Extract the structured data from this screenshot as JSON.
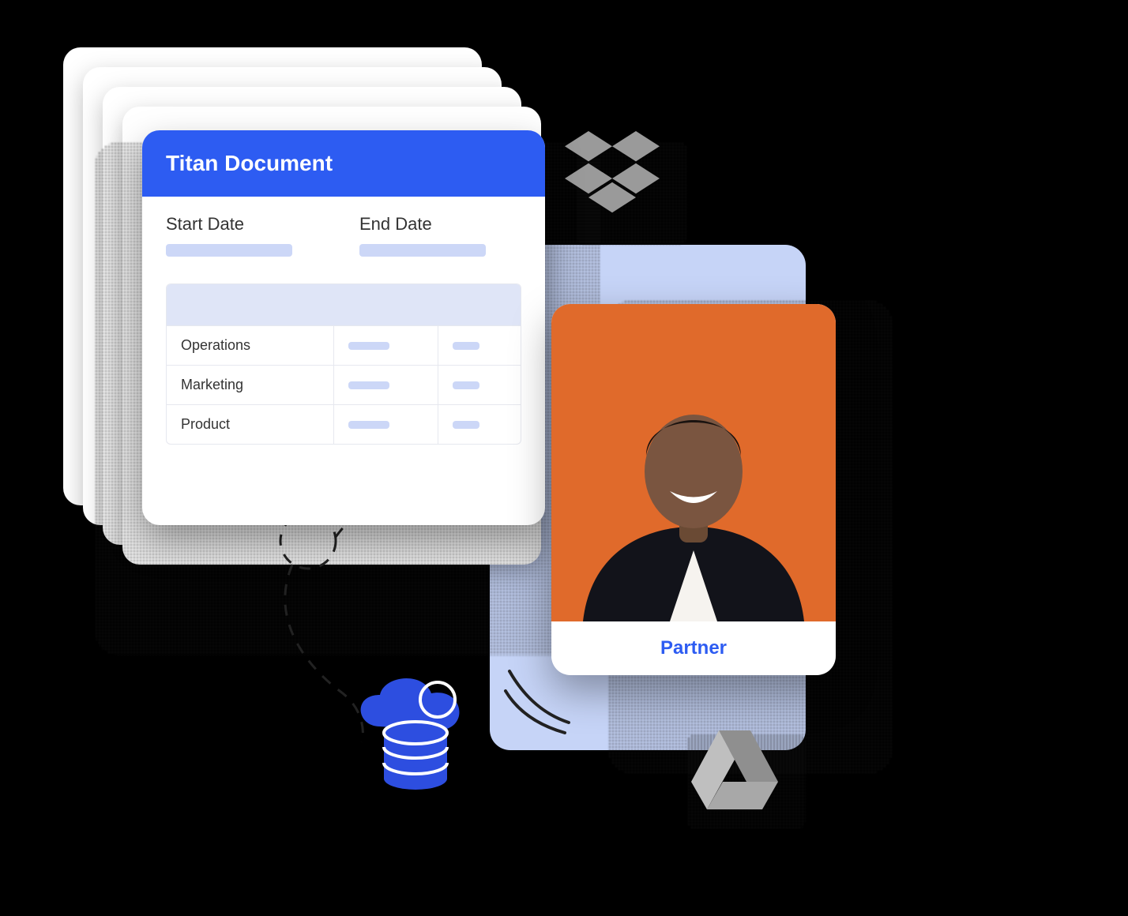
{
  "document": {
    "title": "Titan Document",
    "start_date_label": "Start Date",
    "end_date_label": "End Date",
    "rows": [
      "Operations",
      "Marketing",
      "Product"
    ]
  },
  "partner": {
    "caption": "Partner"
  },
  "icons": {
    "dropbox": "dropbox-icon",
    "cloud_database": "cloud-database-icon",
    "drive": "google-drive-icon"
  },
  "colors": {
    "accent": "#2d5cf2",
    "panel_light": "#c6d4f7",
    "placeholder": "#ccd7f7",
    "photo_bg": "#e06a2b"
  }
}
